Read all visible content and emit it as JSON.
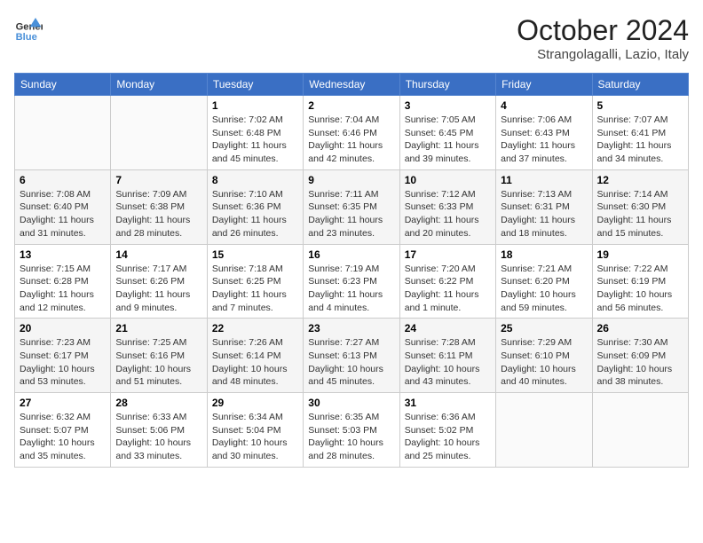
{
  "header": {
    "logo_line1": "General",
    "logo_line2": "Blue",
    "month": "October 2024",
    "location": "Strangolagalli, Lazio, Italy"
  },
  "weekdays": [
    "Sunday",
    "Monday",
    "Tuesday",
    "Wednesday",
    "Thursday",
    "Friday",
    "Saturday"
  ],
  "weeks": [
    [
      {
        "day": "",
        "info": ""
      },
      {
        "day": "",
        "info": ""
      },
      {
        "day": "1",
        "info": "Sunrise: 7:02 AM\nSunset: 6:48 PM\nDaylight: 11 hours and 45 minutes."
      },
      {
        "day": "2",
        "info": "Sunrise: 7:04 AM\nSunset: 6:46 PM\nDaylight: 11 hours and 42 minutes."
      },
      {
        "day": "3",
        "info": "Sunrise: 7:05 AM\nSunset: 6:45 PM\nDaylight: 11 hours and 39 minutes."
      },
      {
        "day": "4",
        "info": "Sunrise: 7:06 AM\nSunset: 6:43 PM\nDaylight: 11 hours and 37 minutes."
      },
      {
        "day": "5",
        "info": "Sunrise: 7:07 AM\nSunset: 6:41 PM\nDaylight: 11 hours and 34 minutes."
      }
    ],
    [
      {
        "day": "6",
        "info": "Sunrise: 7:08 AM\nSunset: 6:40 PM\nDaylight: 11 hours and 31 minutes."
      },
      {
        "day": "7",
        "info": "Sunrise: 7:09 AM\nSunset: 6:38 PM\nDaylight: 11 hours and 28 minutes."
      },
      {
        "day": "8",
        "info": "Sunrise: 7:10 AM\nSunset: 6:36 PM\nDaylight: 11 hours and 26 minutes."
      },
      {
        "day": "9",
        "info": "Sunrise: 7:11 AM\nSunset: 6:35 PM\nDaylight: 11 hours and 23 minutes."
      },
      {
        "day": "10",
        "info": "Sunrise: 7:12 AM\nSunset: 6:33 PM\nDaylight: 11 hours and 20 minutes."
      },
      {
        "day": "11",
        "info": "Sunrise: 7:13 AM\nSunset: 6:31 PM\nDaylight: 11 hours and 18 minutes."
      },
      {
        "day": "12",
        "info": "Sunrise: 7:14 AM\nSunset: 6:30 PM\nDaylight: 11 hours and 15 minutes."
      }
    ],
    [
      {
        "day": "13",
        "info": "Sunrise: 7:15 AM\nSunset: 6:28 PM\nDaylight: 11 hours and 12 minutes."
      },
      {
        "day": "14",
        "info": "Sunrise: 7:17 AM\nSunset: 6:26 PM\nDaylight: 11 hours and 9 minutes."
      },
      {
        "day": "15",
        "info": "Sunrise: 7:18 AM\nSunset: 6:25 PM\nDaylight: 11 hours and 7 minutes."
      },
      {
        "day": "16",
        "info": "Sunrise: 7:19 AM\nSunset: 6:23 PM\nDaylight: 11 hours and 4 minutes."
      },
      {
        "day": "17",
        "info": "Sunrise: 7:20 AM\nSunset: 6:22 PM\nDaylight: 11 hours and 1 minute."
      },
      {
        "day": "18",
        "info": "Sunrise: 7:21 AM\nSunset: 6:20 PM\nDaylight: 10 hours and 59 minutes."
      },
      {
        "day": "19",
        "info": "Sunrise: 7:22 AM\nSunset: 6:19 PM\nDaylight: 10 hours and 56 minutes."
      }
    ],
    [
      {
        "day": "20",
        "info": "Sunrise: 7:23 AM\nSunset: 6:17 PM\nDaylight: 10 hours and 53 minutes."
      },
      {
        "day": "21",
        "info": "Sunrise: 7:25 AM\nSunset: 6:16 PM\nDaylight: 10 hours and 51 minutes."
      },
      {
        "day": "22",
        "info": "Sunrise: 7:26 AM\nSunset: 6:14 PM\nDaylight: 10 hours and 48 minutes."
      },
      {
        "day": "23",
        "info": "Sunrise: 7:27 AM\nSunset: 6:13 PM\nDaylight: 10 hours and 45 minutes."
      },
      {
        "day": "24",
        "info": "Sunrise: 7:28 AM\nSunset: 6:11 PM\nDaylight: 10 hours and 43 minutes."
      },
      {
        "day": "25",
        "info": "Sunrise: 7:29 AM\nSunset: 6:10 PM\nDaylight: 10 hours and 40 minutes."
      },
      {
        "day": "26",
        "info": "Sunrise: 7:30 AM\nSunset: 6:09 PM\nDaylight: 10 hours and 38 minutes."
      }
    ],
    [
      {
        "day": "27",
        "info": "Sunrise: 6:32 AM\nSunset: 5:07 PM\nDaylight: 10 hours and 35 minutes."
      },
      {
        "day": "28",
        "info": "Sunrise: 6:33 AM\nSunset: 5:06 PM\nDaylight: 10 hours and 33 minutes."
      },
      {
        "day": "29",
        "info": "Sunrise: 6:34 AM\nSunset: 5:04 PM\nDaylight: 10 hours and 30 minutes."
      },
      {
        "day": "30",
        "info": "Sunrise: 6:35 AM\nSunset: 5:03 PM\nDaylight: 10 hours and 28 minutes."
      },
      {
        "day": "31",
        "info": "Sunrise: 6:36 AM\nSunset: 5:02 PM\nDaylight: 10 hours and 25 minutes."
      },
      {
        "day": "",
        "info": ""
      },
      {
        "day": "",
        "info": ""
      }
    ]
  ]
}
